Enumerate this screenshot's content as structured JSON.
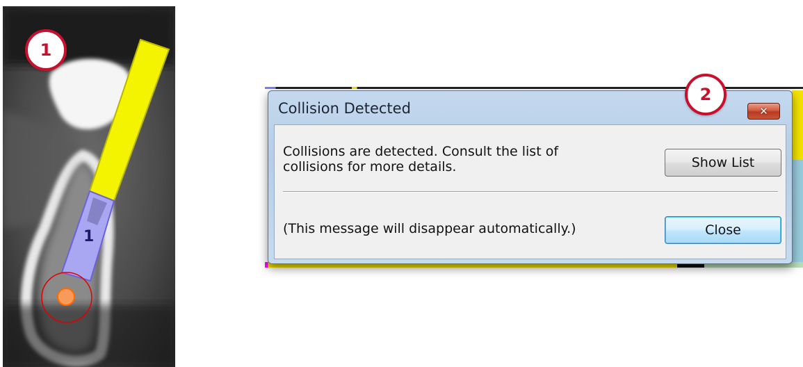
{
  "callouts": {
    "one": "1",
    "two": "2"
  },
  "implant": {
    "number": "1"
  },
  "dialog": {
    "title": "Collision Detected",
    "close_glyph": "✕",
    "message_line1": "Collisions are detected. Consult the list of",
    "message_line2": "collisions for more details.",
    "auto_note": "(This message will disappear automatically.)",
    "show_list_label": "Show List",
    "close_label": "Close"
  },
  "colors": {
    "callout_red": "#c8102e",
    "implant_yellow": "#f4f400",
    "implant_blue": "#a9a6f2",
    "nerve_orange": "#f79a5a"
  }
}
